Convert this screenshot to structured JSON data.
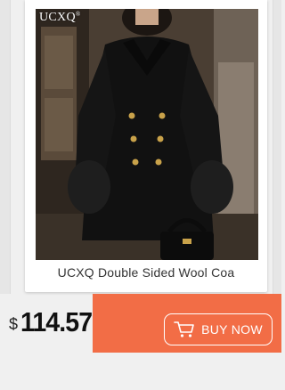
{
  "product": {
    "brand_watermark": "UCXQ",
    "brand_mark": "®",
    "title": "UCXQ Double Sided Wool Coa",
    "image_alt_icon": "product-photo"
  },
  "pricing": {
    "currency": "$",
    "amount": "114.57"
  },
  "cta": {
    "label": "BUY NOW",
    "icon": "shopping-cart-icon"
  },
  "colors": {
    "accent": "#f26d46",
    "card": "#ffffff",
    "background": "#f0f0f0",
    "price_text": "#111111"
  }
}
